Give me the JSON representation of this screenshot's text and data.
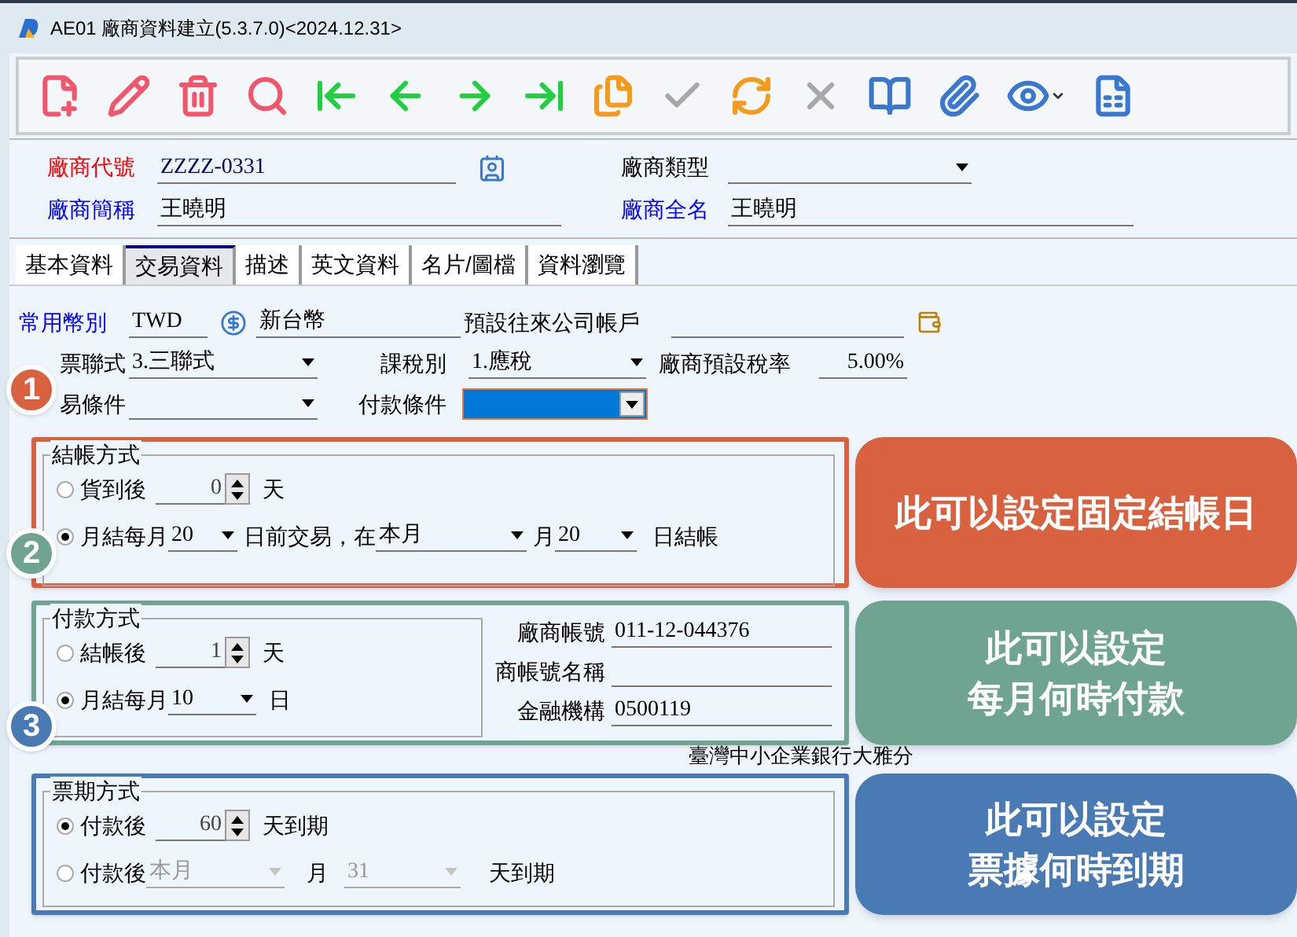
{
  "window": {
    "title": "AE01 廠商資料建立(5.3.7.0)<2024.12.31>"
  },
  "toolbar": [
    {
      "disabled": false
    },
    {
      "disabled": false
    },
    {
      "disabled": false
    },
    {
      "disabled": false
    },
    {
      "disabled": false
    },
    {
      "disabled": false
    },
    {
      "disabled": false
    },
    {
      "disabled": false
    },
    {
      "disabled": false
    },
    {
      "disabled": true
    },
    {
      "disabled": false
    },
    {
      "disabled": true
    },
    {
      "disabled": false
    },
    {
      "disabled": false
    },
    {
      "disabled": false
    },
    {
      "disabled": false
    }
  ],
  "header": {
    "vendor_code": {
      "label": "廠商代號",
      "value": "ZZZZ-0331"
    },
    "vendor_type": {
      "label": "廠商類型"
    },
    "short_name": {
      "label": "廠商簡稱",
      "value": "王曉明"
    },
    "full_name": {
      "label": "廠商全名",
      "value": "王曉明"
    }
  },
  "tabs": [
    {
      "label": "基本資料",
      "selected": false
    },
    {
      "label": "交易資料",
      "selected": true
    },
    {
      "label": "描述",
      "selected": false
    },
    {
      "label": "英文資料",
      "selected": false
    },
    {
      "label": "名片/圖檔",
      "selected": false
    },
    {
      "label": "資料瀏覽",
      "selected": false
    }
  ],
  "trade": {
    "currency": {
      "label": "常用幣別",
      "code": "TWD",
      "name": "新台幣"
    },
    "default_account": {
      "label": "預設往來公司帳戶"
    },
    "invoice_type": {
      "label": "票聯式",
      "value": "3.三聯式"
    },
    "tax_type": {
      "label": "課稅別",
      "value": "1.應稅"
    },
    "tax_rate": {
      "label": "廠商預設稅率",
      "value": "5.00%"
    },
    "trade_terms": {
      "label": "易條件"
    },
    "payment_terms": {
      "label": "付款條件",
      "focused": true
    }
  },
  "closing": {
    "title": "結帳方式",
    "options": [
      {
        "kind": "days",
        "selected": false,
        "prefix": "貨到後",
        "value": "0",
        "suffix": "天"
      },
      {
        "kind": "monthly_close",
        "selected": true,
        "prefix": "月結每月",
        "day": "20",
        "middle": "日前交易，在",
        "month": "本月",
        "unit": "月",
        "close_day": "20",
        "suffix": "日結帳"
      }
    ]
  },
  "payment": {
    "title": "付款方式",
    "options": [
      {
        "kind": "days",
        "selected": false,
        "prefix": "結帳後",
        "value": "1",
        "suffix": "天"
      },
      {
        "kind": "monthly",
        "selected": true,
        "prefix": "月結每月",
        "day": "10",
        "suffix": "日"
      }
    ],
    "bank_fields": [
      {
        "label": "廠商帳號",
        "value": "011-12-044376"
      },
      {
        "label": "商帳號名稱"
      },
      {
        "label": "金融機構",
        "value": "0500119"
      }
    ],
    "bank_name": "臺灣中小企業銀行大雅分"
  },
  "bills": {
    "title": "票期方式",
    "options": [
      {
        "kind": "days",
        "selected": true,
        "prefix": "付款後",
        "value": "60",
        "suffix": "天到期"
      },
      {
        "kind": "month_day",
        "selected": false,
        "prefix": "付款後",
        "month": "本月",
        "unit": "月",
        "day": "31",
        "suffix": "天到期"
      }
    ]
  },
  "annotations": [
    {
      "number": "1",
      "color": "#d8623f",
      "lines": [
        "此可以設定固定結帳日"
      ]
    },
    {
      "number": "2",
      "color": "#6fa590",
      "lines": [
        "此可以設定",
        "每月何時付款"
      ]
    },
    {
      "number": "3",
      "color": "#4a7ab3",
      "lines": [
        "此可以設定",
        "票據何時到期"
      ]
    }
  ]
}
